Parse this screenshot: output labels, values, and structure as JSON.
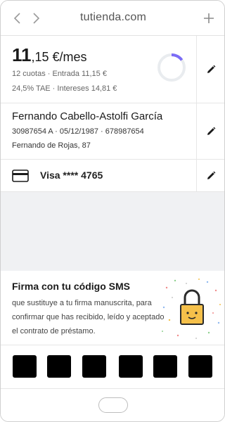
{
  "browser": {
    "url": "tutienda.com",
    "icons": {
      "back": "chevron-left-icon",
      "forward": "chevron-right-icon",
      "add": "plus-icon"
    }
  },
  "loan": {
    "amount_int": "11",
    "amount_dec": ",15",
    "amount_unit": " €/mes",
    "line1": "12 cuotas · Entrada 11,15 €",
    "line2": "24,5% TAE · Intereses 14,81 €",
    "progress_fraction": 0.15,
    "edit_icon": "pencil-icon"
  },
  "person": {
    "name": "Fernando Cabello-Astolfi García",
    "meta": "30987654 A · 05/12/1987 · 678987654",
    "address": "Fernando de Rojas, 87",
    "edit_icon": "pencil-icon"
  },
  "card": {
    "label": "Visa **** 4765",
    "icon": "credit-card-icon",
    "edit_icon": "pencil-icon"
  },
  "sms": {
    "title": "Firma con tu código SMS",
    "description": "que sustituye a tu firma manuscrita, para confirmar que has recibido, leído y aceptado el contrato de préstamo.",
    "illustration": "padlock-icon"
  },
  "code": {
    "digits": [
      "",
      "",
      "",
      "",
      "",
      ""
    ]
  },
  "colors": {
    "ring_track": "#e9ecef",
    "ring_progress": "#7b6cf6",
    "lock_body": "#f5c04a"
  }
}
